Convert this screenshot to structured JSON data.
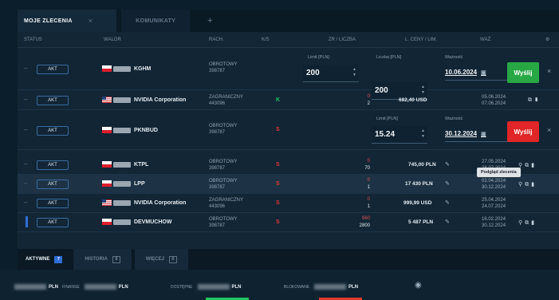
{
  "tabs": {
    "active": "MOJE ZLECENIA",
    "close_glyph": "×",
    "inactive": "KOMUNIKATY",
    "add_glyph": "+"
  },
  "columns": {
    "status": "STATUS",
    "walor": "WALOR",
    "rach": "RACH.",
    "ks": "K/S",
    "zr_liczba": "ZR / LICZBA",
    "l_cena_lim": "L. CENY / LIM.",
    "waz": "WAŻ.",
    "settings_glyph": "⚙"
  },
  "rows": [
    {
      "status": "AKT",
      "flag": "pl",
      "name": "KGHM",
      "account_type": "OBROTOWY",
      "account_no": "398787",
      "side": "",
      "side_color": "",
      "qty_top": "",
      "qty_bottom": "",
      "amount": "",
      "date_top": "",
      "date_bottom": "",
      "edit": {
        "limit_label": "Limit [PLN]",
        "limit_value": "200",
        "qty_label": "Liczba [PLN]",
        "qty_value": "200",
        "date_label": "Ważność",
        "date_value": "10.06.2024",
        "button": "Wyślij",
        "button_color": "#27a844",
        "close": "×"
      }
    },
    {
      "status": "AKT",
      "flag": "us",
      "name": "NVIDIA Corporation",
      "account_type": "ZAGRANICZNY",
      "account_no": "443096",
      "side": "K",
      "side_color": "green",
      "qty_top": "0",
      "qty_bottom": "2",
      "amount": "682,40 USD",
      "date_top": "05.06.2024",
      "date_bottom": "07.06.2024",
      "edit": null
    },
    {
      "status": "AKT",
      "flag": "pl",
      "name": "PKNBUD",
      "account_type": "OBROTOWY",
      "account_no": "398787",
      "side": "S",
      "side_color": "red",
      "qty_top": "",
      "qty_bottom": "",
      "amount": "",
      "date_top": "",
      "date_bottom": "",
      "edit": {
        "limit_label": "Limit [PLN]",
        "limit_value": "15.24",
        "qty_label": "",
        "qty_value": "",
        "date_label": "Ważność",
        "date_value": "30.12.2024",
        "button": "Wyślij",
        "button_color": "#e02626",
        "close": "×"
      }
    },
    {
      "status": "AKT",
      "flag": "pl",
      "name": "KTPL",
      "account_type": "OBROTOWY",
      "account_no": "398787",
      "side": "S",
      "side_color": "red",
      "qty_top": "0",
      "qty_bottom": "70",
      "amount": "745,00 PLN",
      "date_top": "27.05.2024",
      "date_bottom": "28.07.2024",
      "edit": null
    },
    {
      "status": "AKT",
      "flag": "pl",
      "name": "LPP",
      "account_type": "OBROTOWY",
      "account_no": "398787",
      "side": "S",
      "side_color": "red",
      "qty_top": "0",
      "qty_bottom": "1",
      "amount": "17 430 PLN",
      "date_top": "02.04.2024",
      "date_bottom": "30.12.2024",
      "edit": null
    },
    {
      "status": "AKT",
      "flag": "us",
      "name": "NVIDIA Corporation",
      "account_type": "ZAGRANICZNY",
      "account_no": "443096",
      "side": "S",
      "side_color": "red",
      "qty_top": "0",
      "qty_bottom": "1",
      "amount": "999,99 USD",
      "date_top": "25.04.2024",
      "date_bottom": "24.07.2024",
      "edit": null
    },
    {
      "status": "AKT",
      "flag": "pl",
      "name": "DEVMUCHOW",
      "account_type": "OBROTOWY",
      "account_no": "398787",
      "side": "S",
      "side_color": "red",
      "qty_top": "960",
      "qty_bottom": "2800",
      "amount": "5 487 PLN",
      "date_top": "16.02.2024",
      "date_bottom": "30.12.2024",
      "edit": null
    }
  ],
  "tooltip": "Podgląd zlecenia",
  "bottom_tabs": [
    {
      "label": "AKTYWNE",
      "count": "7",
      "style": "blue"
    },
    {
      "label": "HISTORIA",
      "count": "0",
      "style": "out"
    },
    {
      "label": "WIĘCEJ",
      "count": "0",
      "style": "out"
    }
  ],
  "footer": [
    {
      "key": "",
      "value": "PLN"
    },
    {
      "key": "FINANSE",
      "value": "PLN"
    },
    {
      "key": "DOSTĘPNE",
      "value": "PLN"
    },
    {
      "key": "BLOKOWANE",
      "value": "PLN"
    }
  ],
  "colors": {
    "buy": "#22c55e",
    "sell": "#e53935",
    "accent": "#2f6fd6"
  }
}
